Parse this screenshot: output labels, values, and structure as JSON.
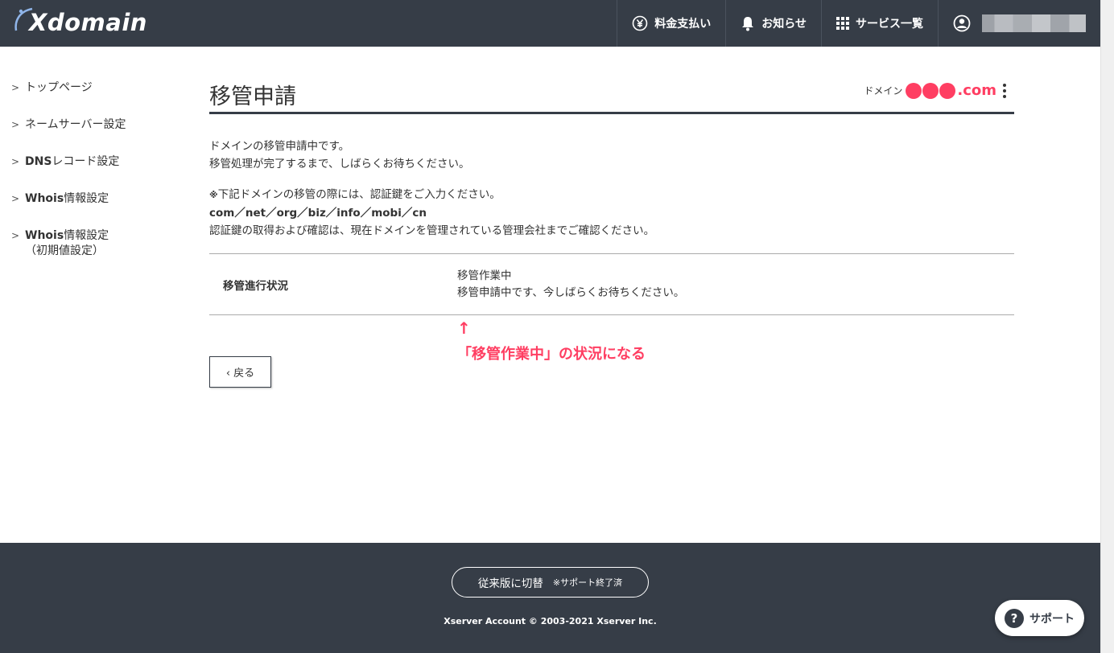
{
  "header": {
    "logo_text": "Xdomain",
    "nav": {
      "payment": "料金支払い",
      "notice": "お知らせ",
      "services": "サービス一覧"
    }
  },
  "sidebar": {
    "items": [
      {
        "label": "トップページ"
      },
      {
        "label": "ネームサーバー設定"
      },
      {
        "label_bold": "DNS",
        "label_rest": "レコード設定"
      },
      {
        "label_bold": "Whois",
        "label_rest": "情報設定"
      },
      {
        "label_bold": "Whois",
        "label_rest": "情報設定",
        "label_sub": "（初期値設定）"
      }
    ]
  },
  "main": {
    "title": "移管申請",
    "domain_label": "ドメイン",
    "domain_suffix": ".com",
    "message_line1": "ドメインの移管申請中です。",
    "message_line2": "移管処理が完了するまで、しばらくお待ちください。",
    "note_mark": "※",
    "note_line1": "下記ドメインの移管の際には、認証鍵をご入力ください。",
    "note_tlds": "com／net／org／biz／info／mobi／cn",
    "note_line3": "認証鍵の取得および確認は、現在ドメインを管理されている管理会社までご確認ください。",
    "status": {
      "label": "移管進行状況",
      "value_line1": "移管作業中",
      "value_line2": "移管申請中です、今しばらくお待ちください。"
    },
    "annotation_arrow": "↑",
    "annotation_text": "「移管作業中」の状況になる",
    "back_button": "‹ 戻る"
  },
  "footer": {
    "legacy_button": "従来版に切替",
    "legacy_note": "※サポート終了済",
    "copyright": "Xserver Account © 2003-2021 Xserver Inc."
  },
  "support_button": "サポート",
  "colors": {
    "header_bg": "#363d47",
    "accent_red": "#ff3e62"
  }
}
